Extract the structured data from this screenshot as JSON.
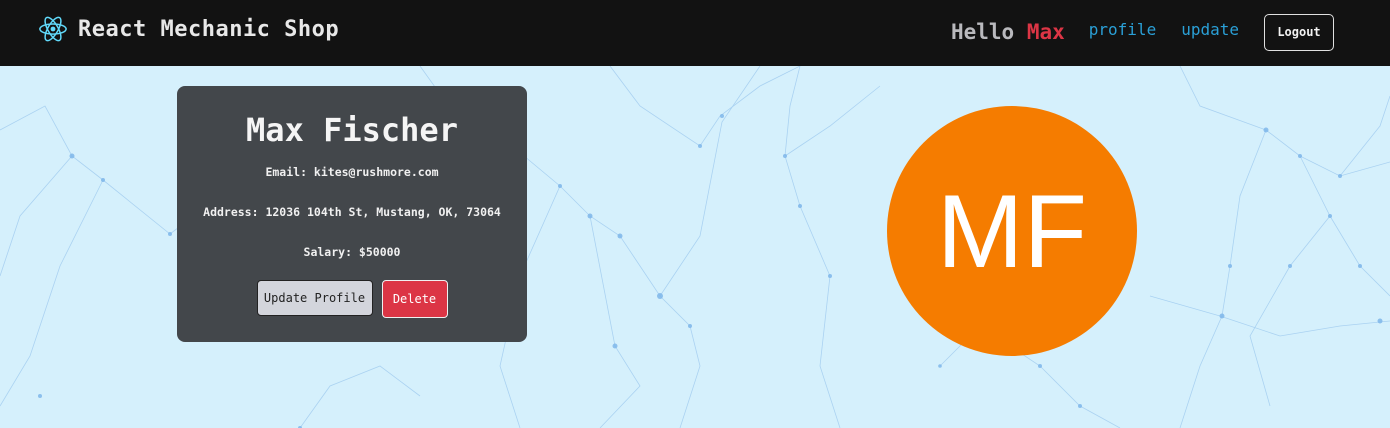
{
  "navbar": {
    "brand_text": "React Mechanic Shop",
    "brand_icon": "react-atom-icon",
    "greeting_prefix": "Hello",
    "greeting_name": "Max",
    "links": [
      {
        "label": "profile"
      },
      {
        "label": "update"
      }
    ],
    "logout_label": "Logout"
  },
  "profile_card": {
    "name": "Max Fischer",
    "email_line": "Email: kites@rushmore.com",
    "address_line": "Address: 12036 104th St, Mustang, OK, 73064",
    "salary_line": "Salary: $50000",
    "update_button_label": "Update Profile",
    "delete_button_label": "Delete"
  },
  "avatar": {
    "initials": "MF"
  },
  "colors": {
    "navbar_bg": "#121212",
    "page_bg": "#d5f0fc",
    "card_bg": "#43474b",
    "accent_red": "#dc3545",
    "link_blue": "#2a9fd6",
    "avatar_orange": "#f57c00",
    "react_cyan": "#61dafb"
  }
}
